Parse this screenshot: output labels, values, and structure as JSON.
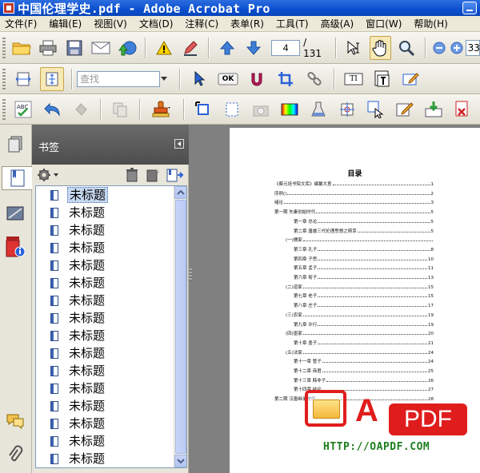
{
  "window": {
    "title": "中国伦理学史.pdf - Adobe Acrobat Pro"
  },
  "menu": [
    "文件(F)",
    "编辑(E)",
    "视图(V)",
    "文档(D)",
    "注释(C)",
    "表单(R)",
    "工具(T)",
    "高级(A)",
    "窗口(W)",
    "帮助(H)"
  ],
  "toolbar": {
    "page_current": "4",
    "page_total": "/ 131",
    "zoom_value": "33",
    "find_placeholder": "查找",
    "ok_label": "OK",
    "text_tool_label": "TI"
  },
  "bookmarks": {
    "title": "书签",
    "items": [
      "未标题",
      "未标题",
      "未标题",
      "未标题",
      "未标题",
      "未标题",
      "未标题",
      "未标题",
      "未标题",
      "未标题",
      "未标题",
      "未标题",
      "未标题",
      "未标题",
      "未标题",
      "未标题"
    ]
  },
  "document": {
    "toc_title": "目录",
    "toc": [
      {
        "t": "《蔡元培书院文库》编纂大意",
        "p": "1",
        "indent": 0
      },
      {
        "t": "序例()",
        "p": "2",
        "indent": 0
      },
      {
        "t": "绪论",
        "p": "3",
        "indent": 0
      },
      {
        "t": "第一期 先秦创始时代",
        "p": "5",
        "indent": 0
      },
      {
        "t": "第一章 总论",
        "p": "5",
        "indent": 2
      },
      {
        "t": "第二章 唐虞三代伦理思想之萌芽",
        "p": "5",
        "indent": 2
      },
      {
        "t": "(一)儒家",
        "p": "",
        "indent": 1
      },
      {
        "t": "第三章 孔子",
        "p": "8",
        "indent": 2
      },
      {
        "t": "第四章 子思",
        "p": "10",
        "indent": 2
      },
      {
        "t": "第五章 孟子",
        "p": "11",
        "indent": 2
      },
      {
        "t": "第六章 荀子",
        "p": "13",
        "indent": 2
      },
      {
        "t": "(二)道家",
        "p": "15",
        "indent": 1
      },
      {
        "t": "第七章 老子",
        "p": "15",
        "indent": 2
      },
      {
        "t": "第八章 庄子",
        "p": "17",
        "indent": 2
      },
      {
        "t": "(三)农家",
        "p": "19",
        "indent": 1
      },
      {
        "t": "第九章 许行",
        "p": "19",
        "indent": 2
      },
      {
        "t": "(四)墨家",
        "p": "20",
        "indent": 1
      },
      {
        "t": "第十章 墨子",
        "p": "21",
        "indent": 2
      },
      {
        "t": "(五)法家",
        "p": "24",
        "indent": 1
      },
      {
        "t": "第十一章 管子",
        "p": "24",
        "indent": 2
      },
      {
        "t": "第十二章 商君",
        "p": "25",
        "indent": 2
      },
      {
        "t": "第十三章 韩非子",
        "p": "26",
        "indent": 2
      },
      {
        "t": "第十四章 结论",
        "p": "27",
        "indent": 2
      },
      {
        "t": "第二期 汉唐继承时代",
        "p": "28",
        "indent": 0
      }
    ]
  },
  "watermark": {
    "letter": "A",
    "badge": "PDF",
    "url": "HTTP://OAPDF.COM"
  },
  "colors": {
    "titlebar": "#0a4fcf",
    "watermark_red": "#e01d1d",
    "url_green": "#1e7d1e"
  }
}
